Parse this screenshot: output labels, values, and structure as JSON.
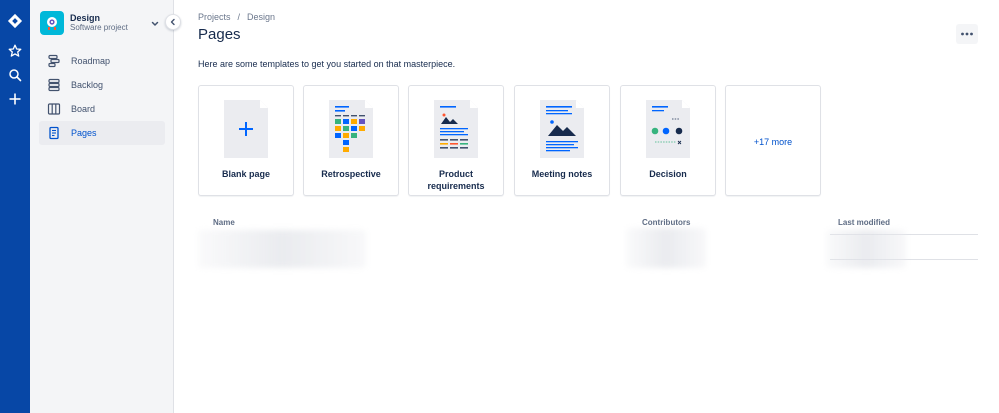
{
  "global_nav": {
    "icons": [
      "jira-logo-icon",
      "star-icon",
      "search-icon",
      "plus-icon"
    ]
  },
  "project": {
    "name": "Design",
    "type": "Software project",
    "avatar_color": "#00b8d9"
  },
  "sidebar": {
    "items": [
      {
        "label": "Roadmap",
        "icon": "roadmap-icon",
        "active": false
      },
      {
        "label": "Backlog",
        "icon": "backlog-icon",
        "active": false
      },
      {
        "label": "Board",
        "icon": "board-icon",
        "active": false
      },
      {
        "label": "Pages",
        "icon": "pages-icon",
        "active": true
      }
    ]
  },
  "breadcrumb": {
    "items": [
      "Projects",
      "Design"
    ],
    "separator": "/"
  },
  "page": {
    "title": "Pages",
    "intro": "Here are some templates to get you started on that masterpiece."
  },
  "templates": [
    {
      "label": "Blank page"
    },
    {
      "label": "Retrospective"
    },
    {
      "label": "Product requirements"
    },
    {
      "label": "Meeting notes"
    },
    {
      "label": "Decision"
    }
  ],
  "more_templates": {
    "label": "+17 more"
  },
  "table": {
    "headers": {
      "name": "Name",
      "contributors": "Contributors",
      "last_modified": "Last modified"
    }
  },
  "colors": {
    "global_nav": "#0747a6",
    "accent": "#0052cc",
    "sidebar_bg": "#f4f5f7"
  }
}
